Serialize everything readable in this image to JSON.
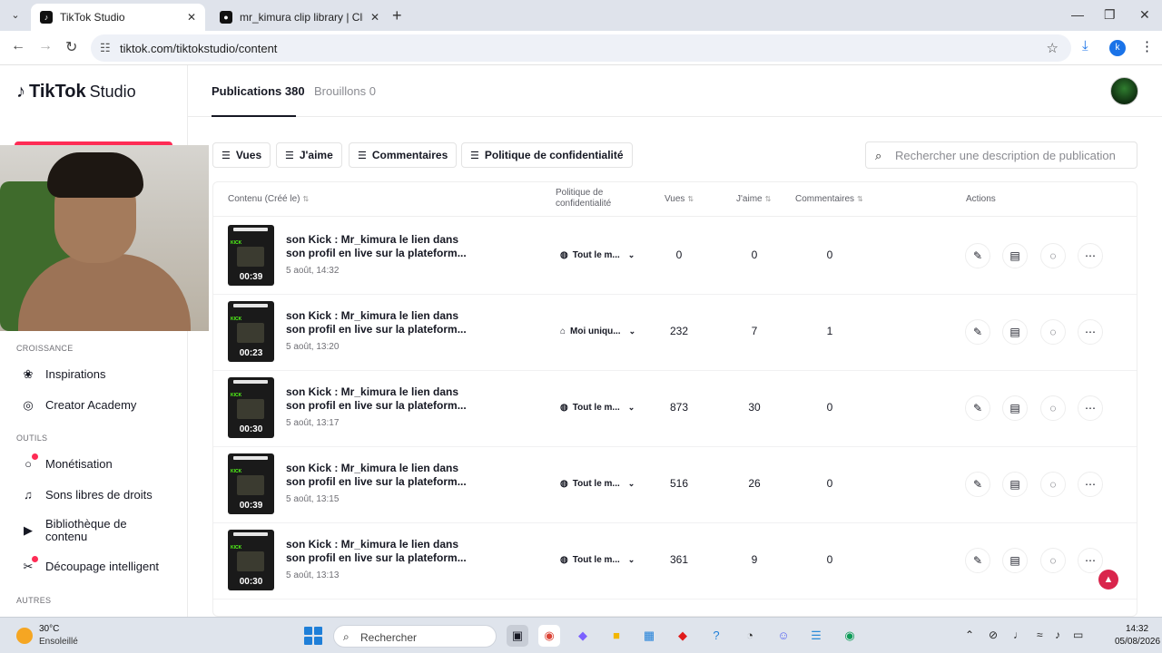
{
  "browser": {
    "tabs": [
      {
        "title": "TikTok Studio",
        "active": true
      },
      {
        "title": "mr_kimura clip library | ClipLabz",
        "active": false
      }
    ],
    "url": "tiktok.com/tiktokstudio/content",
    "profile_initial": "k"
  },
  "sidebar": {
    "logo_text": "TikTok",
    "logo_sub": "Studio",
    "sections": [
      {
        "title": "CROISSANCE",
        "items": [
          {
            "label": "Inspirations",
            "icon": "lightbulb-icon",
            "dot": false
          },
          {
            "label": "Creator Academy",
            "icon": "academy-icon",
            "dot": false
          }
        ]
      },
      {
        "title": "OUTILS",
        "items": [
          {
            "label": "Monétisation",
            "icon": "money-icon",
            "dot": true
          },
          {
            "label": "Sons libres de droits",
            "icon": "music-icon",
            "dot": false
          },
          {
            "label": "Bibliothèque de contenu",
            "icon": "library-icon",
            "dot": false
          },
          {
            "label": "Découpage intelligent",
            "icon": "clip-icon",
            "dot": true
          }
        ]
      },
      {
        "title": "AUTRES",
        "items": []
      }
    ]
  },
  "header": {
    "tab_published": "Publications 380",
    "tab_drafts": "Brouillons 0"
  },
  "filters": [
    "Vues",
    "J'aime",
    "Commentaires",
    "Politique de confidentialité"
  ],
  "search": {
    "placeholder": "Rechercher une description de publication"
  },
  "table": {
    "columns": {
      "content": "Contenu (Créé le)",
      "privacy": "Politique de confidentialité",
      "views": "Vues",
      "likes": "J'aime",
      "comments": "Commentaires",
      "actions": "Actions"
    },
    "rows": [
      {
        "duration": "00:39",
        "desc": "son Kick : Mr_kimura le lien dans son profil en live sur la plateform...",
        "date": "5 août, 14:32",
        "privacy": "Tout le m...",
        "privacy_icon": "globe-icon",
        "views": "0",
        "likes": "0",
        "comments": "0"
      },
      {
        "duration": "00:23",
        "desc": "son Kick : Mr_kimura le lien dans son profil en live sur la plateform...",
        "date": "5 août, 13:20",
        "privacy": "Moi uniqu...",
        "privacy_icon": "lock-icon",
        "views": "232",
        "likes": "7",
        "comments": "1"
      },
      {
        "duration": "00:30",
        "desc": "son Kick : Mr_kimura le lien dans son profil en live sur la plateform...",
        "date": "5 août, 13:17",
        "privacy": "Tout le m...",
        "privacy_icon": "globe-icon",
        "views": "873",
        "likes": "30",
        "comments": "0"
      },
      {
        "duration": "00:39",
        "desc": "son Kick : Mr_kimura le lien dans son profil en live sur la plateform...",
        "date": "5 août, 13:15",
        "privacy": "Tout le m...",
        "privacy_icon": "globe-icon",
        "views": "516",
        "likes": "26",
        "comments": "0"
      },
      {
        "duration": "00:30",
        "desc": "son Kick : Mr_kimura le lien dans son profil en live sur la plateform...",
        "date": "5 août, 13:13",
        "privacy": "Tout le m...",
        "privacy_icon": "globe-icon",
        "views": "361",
        "likes": "9",
        "comments": "0"
      }
    ]
  },
  "taskbar": {
    "weather_temp": "30°C",
    "weather_desc": "Ensoleillé",
    "search_label": "Rechercher",
    "time": "14:32",
    "date": "05/08/2026"
  },
  "colors": {
    "accent": "#fe2c55",
    "kick_green": "#53fc18"
  }
}
